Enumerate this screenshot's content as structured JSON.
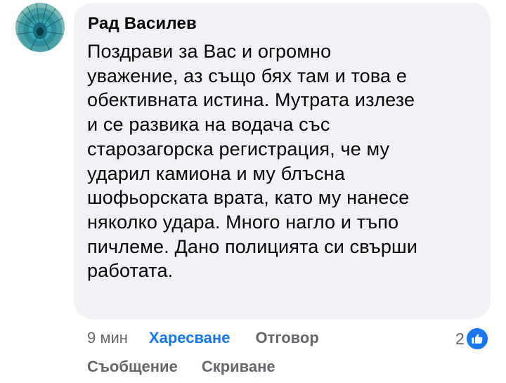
{
  "comment": {
    "author": "Рад Василев",
    "text": "Поздрави за Вас и огромно\nуважение, аз също бях там и това е\nобективната истина. Мутрата излезе\nи се развика на водача със\nстарозагорска регистрация, че му\nударил камиона и му блъсна\nшофьорската врата, като му нанесе\nняколко удара. Много нагло и тъпо\nпичлеме. Дано  полицията си свърши\nработата."
  },
  "actions": {
    "time": "9 мин",
    "like_label": "Харесване",
    "reply_label": "Отговор",
    "message_label": "Съобщение",
    "hide_label": "Скриване"
  },
  "reactions": {
    "count": "2",
    "icon": "thumbs-up-icon",
    "color": "#1877f2"
  },
  "colors": {
    "bubble": "#f0f2f5",
    "text": "#050505",
    "muted": "#65676b",
    "accent": "#1877f2"
  }
}
